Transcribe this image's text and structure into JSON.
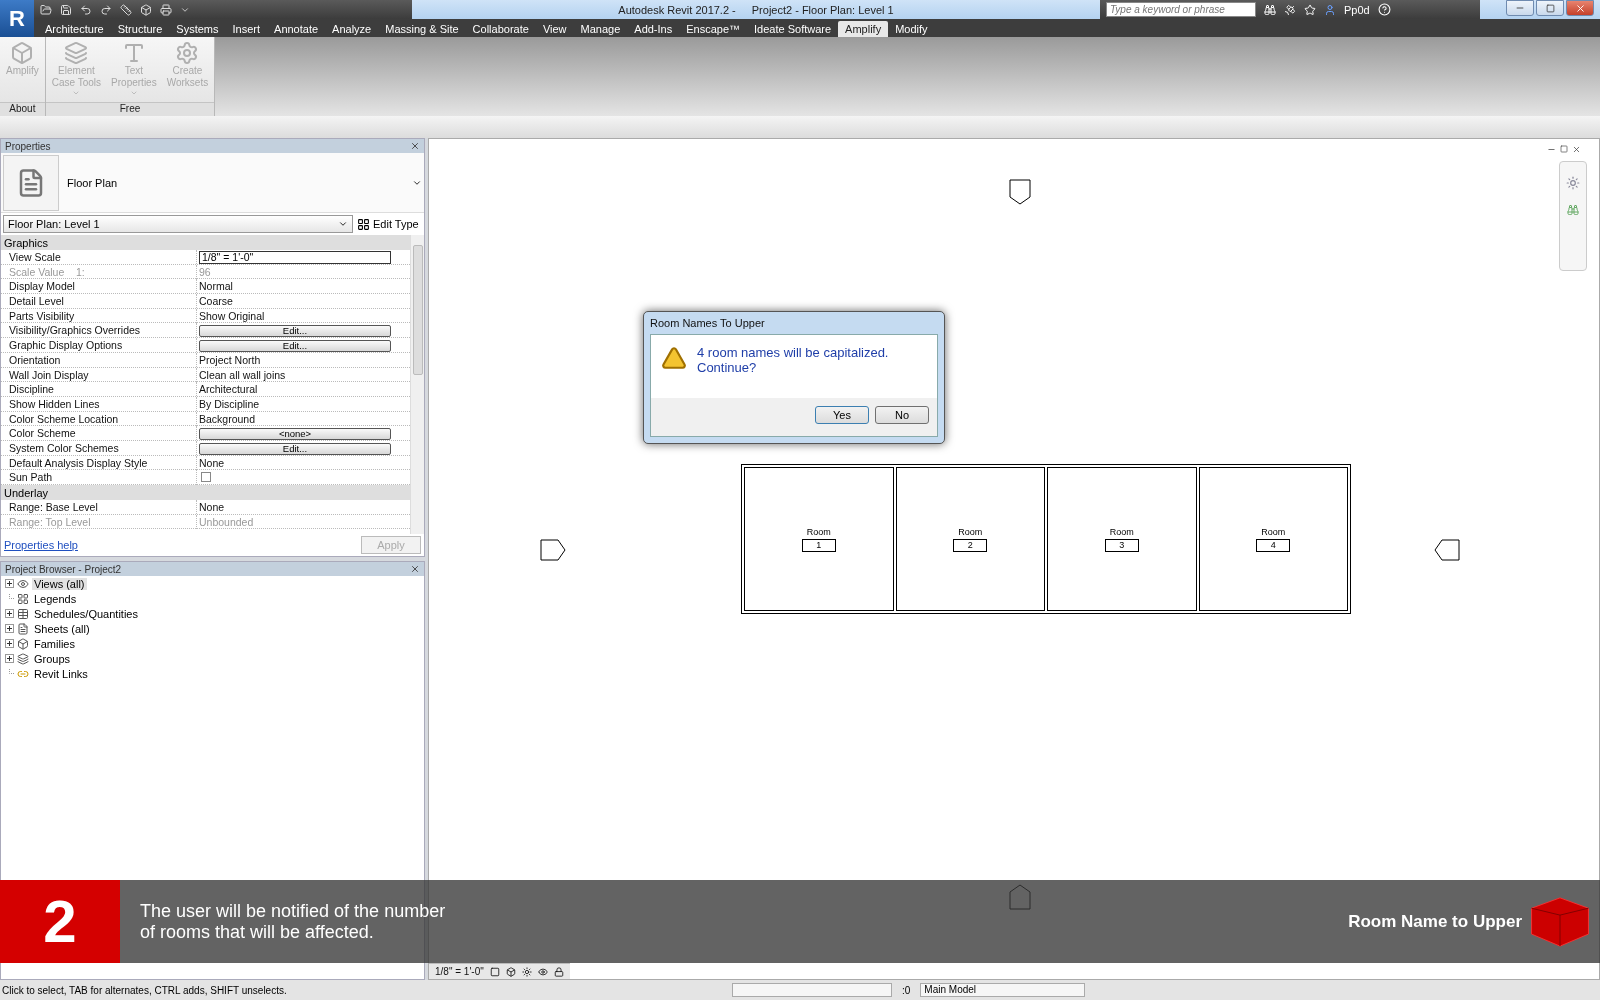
{
  "app_logo": "R",
  "window": {
    "app_title": "Autodesk Revit 2017.2 -",
    "document_title": "Project2 - Floor Plan: Level 1"
  },
  "search": {
    "placeholder": "Type a keyword or phrase"
  },
  "user": "Pp0d",
  "ribbon_tabs": [
    {
      "label": "Architecture",
      "selected": false
    },
    {
      "label": "Structure",
      "selected": false
    },
    {
      "label": "Systems",
      "selected": false
    },
    {
      "label": "Insert",
      "selected": false
    },
    {
      "label": "Annotate",
      "selected": false
    },
    {
      "label": "Analyze",
      "selected": false
    },
    {
      "label": "Massing & Site",
      "selected": false
    },
    {
      "label": "Collaborate",
      "selected": false
    },
    {
      "label": "View",
      "selected": false
    },
    {
      "label": "Manage",
      "selected": false
    },
    {
      "label": "Add-Ins",
      "selected": false
    },
    {
      "label": "Enscape™",
      "selected": false
    },
    {
      "label": "Ideate Software",
      "selected": false
    },
    {
      "label": "Amplify",
      "selected": true
    },
    {
      "label": "Modify",
      "selected": false
    }
  ],
  "ribbon_panels": [
    {
      "title": "About",
      "tools": [
        {
          "label": "Amplify",
          "dropdown": false,
          "disabled": true
        }
      ]
    },
    {
      "title": "Free",
      "tools": [
        {
          "label": "Element\nCase Tools",
          "dropdown": true,
          "disabled": true
        },
        {
          "label": "Text\nProperties",
          "dropdown": true,
          "disabled": true
        },
        {
          "label": "Create\nWorksets",
          "dropdown": false,
          "disabled": true
        }
      ]
    }
  ],
  "properties": {
    "title": "Properties",
    "type_name": "Floor Plan",
    "type_selector": "Floor Plan: Level 1",
    "edit_type": "Edit Type",
    "groups": [
      {
        "name": "Graphics",
        "rows": [
          {
            "label": "View Scale",
            "value": "1/8\" = 1'-0\"",
            "kind": "field",
            "disabled": false
          },
          {
            "label": "Scale Value    1:",
            "value": "96",
            "kind": "text",
            "disabled": true
          },
          {
            "label": "Display Model",
            "value": "Normal",
            "kind": "text",
            "disabled": false
          },
          {
            "label": "Detail Level",
            "value": "Coarse",
            "kind": "text",
            "disabled": false
          },
          {
            "label": "Parts Visibility",
            "value": "Show Original",
            "kind": "text",
            "disabled": false
          },
          {
            "label": "Visibility/Graphics Overrides",
            "value": "Edit...",
            "kind": "button",
            "disabled": false
          },
          {
            "label": "Graphic Display Options",
            "value": "Edit...",
            "kind": "button",
            "disabled": false
          },
          {
            "label": "Orientation",
            "value": "Project North",
            "kind": "text",
            "disabled": false
          },
          {
            "label": "Wall Join Display",
            "value": "Clean all wall joins",
            "kind": "text",
            "disabled": false
          },
          {
            "label": "Discipline",
            "value": "Architectural",
            "kind": "text",
            "disabled": false
          },
          {
            "label": "Show Hidden Lines",
            "value": "By Discipline",
            "kind": "text",
            "disabled": false
          },
          {
            "label": "Color Scheme Location",
            "value": "Background",
            "kind": "text",
            "disabled": false
          },
          {
            "label": "Color Scheme",
            "value": "<none>",
            "kind": "button",
            "disabled": false
          },
          {
            "label": "System Color Schemes",
            "value": "Edit...",
            "kind": "button",
            "disabled": false
          },
          {
            "label": "Default Analysis Display Style",
            "value": "None",
            "kind": "text",
            "disabled": false
          },
          {
            "label": "Sun Path",
            "checked": false,
            "kind": "checkbox",
            "disabled": false
          }
        ]
      },
      {
        "name": "Underlay",
        "rows": [
          {
            "label": "Range: Base Level",
            "value": "None",
            "kind": "text",
            "disabled": false
          },
          {
            "label": "Range: Top Level",
            "value": "Unbounded",
            "kind": "text",
            "disabled": true
          }
        ]
      }
    ],
    "help": "Properties help",
    "apply": {
      "label": "Apply",
      "disabled": true
    }
  },
  "project_browser": {
    "title": "Project Browser - Project2",
    "items": [
      {
        "label": "Views (all)",
        "has_children": true,
        "selected": true
      },
      {
        "label": "Legends",
        "has_children": false,
        "selected": false
      },
      {
        "label": "Schedules/Quantities",
        "has_children": true,
        "selected": false
      },
      {
        "label": "Sheets (all)",
        "has_children": true,
        "selected": false
      },
      {
        "label": "Families",
        "has_children": true,
        "selected": false
      },
      {
        "label": "Groups",
        "has_children": true,
        "selected": false
      },
      {
        "label": "Revit Links",
        "has_children": false,
        "selected": false
      }
    ]
  },
  "dialog": {
    "title": "Room Names To Upper",
    "message": "4 room names will be capitalized.\nContinue?",
    "buttons": [
      {
        "label": "Yes",
        "default": true
      },
      {
        "label": "No",
        "default": false
      }
    ]
  },
  "rooms": [
    {
      "name": "Room",
      "number": "1"
    },
    {
      "name": "Room",
      "number": "2"
    },
    {
      "name": "Room",
      "number": "3"
    },
    {
      "name": "Room",
      "number": "4"
    }
  ],
  "view_control": {
    "scale": "1/8\" = 1'-0\""
  },
  "status_bar": {
    "hint": "Click to select, TAB for alternates, CTRL adds, SHIFT unselects.",
    "selection_count": ":0",
    "workset": "Main Model"
  },
  "caption": {
    "step": "2",
    "text": "The user will be notified of the number\nof rooms that will be affected.",
    "title": "Room Name to Upper"
  }
}
